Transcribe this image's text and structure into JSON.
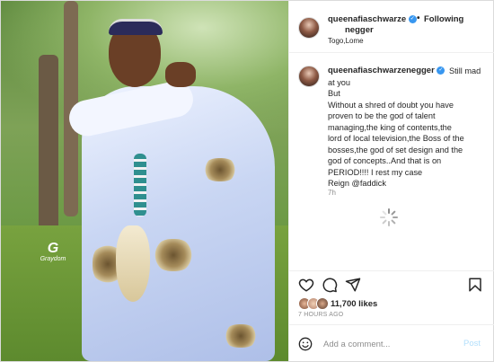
{
  "header": {
    "username_line1": "queenafiaschwarze",
    "username_line2": "negger",
    "dot": "•",
    "following_label": "Following",
    "location": "Togo,Lome",
    "verified_icon": "verified-check-icon"
  },
  "media": {
    "watermark_logo": "G",
    "watermark_text": "Graydom"
  },
  "caption": {
    "username": "queenafiaschwarzenegger",
    "lines": [
      "Still mad",
      "at you",
      "But",
      "Without a shred of doubt you have",
      "proven to be the god of talent",
      "managing,the king of contents,the",
      "lord of local television,the Boss of the",
      "bosses,the god of set design and the",
      "god of concepts..And that is on",
      "PERIOD!!!! I rest my case",
      "Reign @faddick"
    ],
    "time": "7h"
  },
  "actions": {
    "like_icon": "heart-icon",
    "comment_icon": "comment-icon",
    "share_icon": "paper-plane-icon",
    "save_icon": "bookmark-icon"
  },
  "likes": {
    "count": "11,700 likes",
    "posted_ago": "7 HOURS AGO"
  },
  "comment_bar": {
    "emoji_icon": "smiley-icon",
    "placeholder": "Add a comment...",
    "post_label": "Post"
  },
  "colors": {
    "accent_blue": "#3897f0",
    "post_disabled": "#b2dffc",
    "border": "#dbdbdb",
    "muted": "#8e8e8e"
  }
}
